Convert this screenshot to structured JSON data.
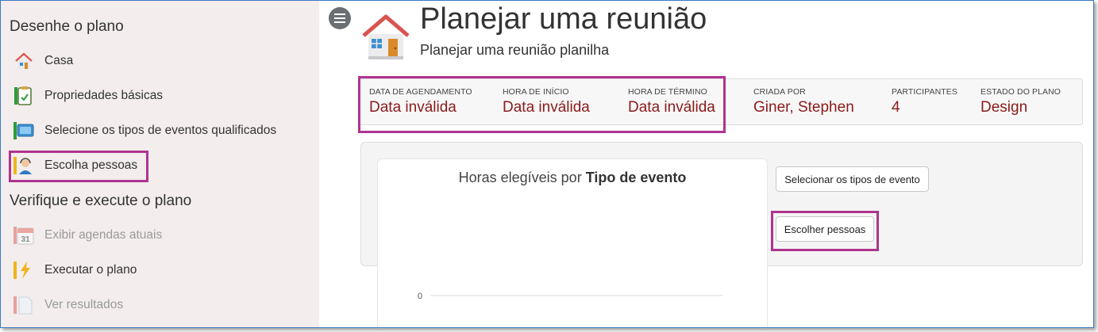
{
  "sidebar": {
    "section1_title": "Desenhe o plano",
    "section2_title": "Verifique e execute o plano",
    "items": [
      {
        "label": "Casa",
        "icon": "house-icon",
        "disabled": false
      },
      {
        "label": "Propriedades básicas",
        "icon": "clipboard-check-icon",
        "disabled": false
      },
      {
        "label": "Selecione os tipos de eventos qualificados",
        "icon": "monitor-icon",
        "disabled": false
      },
      {
        "label": "Escolha pessoas",
        "icon": "person-headset-icon",
        "disabled": false
      },
      {
        "label": "Exibir agendas atuais",
        "icon": "calendar-icon",
        "disabled": true
      },
      {
        "label": "Executar o plano",
        "icon": "lightning-icon",
        "disabled": false
      },
      {
        "label": "Ver resultados",
        "icon": "document-icon",
        "disabled": true
      }
    ],
    "calendar_day": "31"
  },
  "header": {
    "title": "Planejar uma reunião",
    "subtitle": "Planejar uma reunião planilha"
  },
  "info": [
    {
      "label": "DATA DE AGENDAMENTO",
      "value": "Data inválida"
    },
    {
      "label": "HORA DE INÍCIO",
      "value": "Data inválida"
    },
    {
      "label": "HORA DE TÉRMINO",
      "value": "Data inválida"
    },
    {
      "label": "CRIADA POR",
      "value": "Giner, Stephen"
    },
    {
      "label": "PARTICIPANTES",
      "value": "4"
    },
    {
      "label": "ESTADO DO PLANO",
      "value": "Design"
    }
  ],
  "chart": {
    "title_prefix": "Horas elegíveis por ",
    "title_bold": "Tipo de evento",
    "y_tick": "0"
  },
  "chart_data": {
    "type": "bar",
    "title": "Horas elegíveis por Tipo de evento",
    "categories": [],
    "values": [],
    "yticks": [
      0
    ]
  },
  "buttons": {
    "select_event_types": "Selecionar os tipos de evento",
    "choose_people": "Escolher pessoas"
  },
  "colors": {
    "highlight": "#b0338f",
    "value_text": "#8b1a1a",
    "frame_border": "#3b78c4",
    "sidebar_bg": "#f3eded"
  }
}
